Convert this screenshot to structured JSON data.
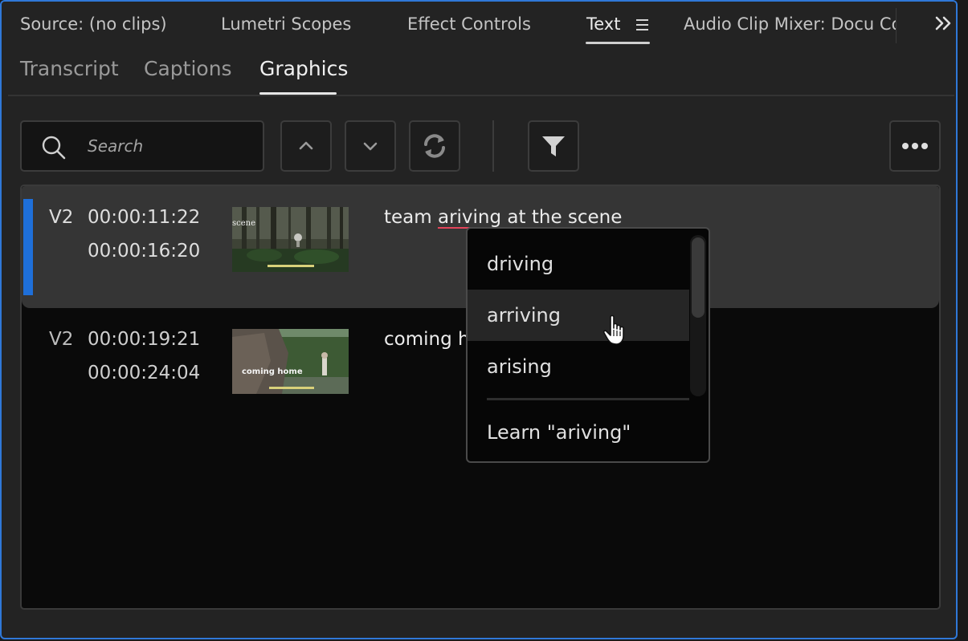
{
  "panel_tabs": [
    {
      "label": "Source: (no clips)"
    },
    {
      "label": "Lumetri Scopes"
    },
    {
      "label": "Effect Controls"
    },
    {
      "label": "Text"
    },
    {
      "label": "Audio Clip Mixer: Docu Cop"
    }
  ],
  "panel_tabs_overflow_icon": "double-chevron-right-icon",
  "panel_menu_icon": "hamburger-menu-icon",
  "sub_tabs": [
    {
      "label": "Transcript"
    },
    {
      "label": "Captions"
    },
    {
      "label": "Graphics"
    }
  ],
  "active_sub_tab": "Graphics",
  "toolbar": {
    "search_placeholder": "Search",
    "search_value": "",
    "buttons": [
      "chevron-up-icon",
      "chevron-down-icon",
      "refresh-icon",
      "filter-icon",
      "more-icon"
    ]
  },
  "graphics": [
    {
      "track": "V2",
      "in": "00:00:11:22",
      "out": "00:00:16:20",
      "text_before": "team ",
      "misspelled": "ariving",
      "text_after": " at the scene",
      "thumb_overlay": "scene",
      "selected": true
    },
    {
      "track": "V2",
      "in": "00:00:19:21",
      "out": "00:00:24:04",
      "text_before": "coming h",
      "thumb_overlay": "coming home",
      "selected": false
    }
  ],
  "spell_menu": {
    "suggestions": [
      "driving",
      "arriving",
      "arising"
    ],
    "hovered": "arriving",
    "learn_label": "Learn \"ariving\""
  },
  "colors": {
    "accent": "#1e6fd9",
    "focus_border": "#2f78d8",
    "misspell_underline": "#e3445a"
  }
}
